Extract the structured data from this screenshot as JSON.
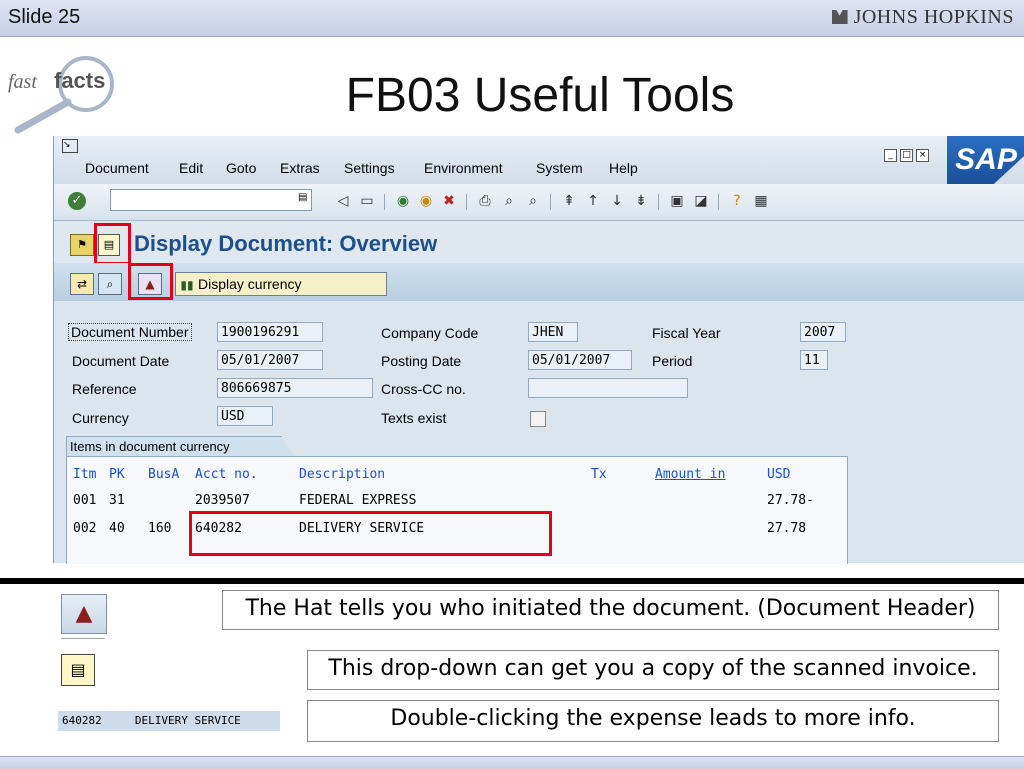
{
  "slide": {
    "number_label": "Slide 25",
    "logo_text": "JOHNS HOPKINS",
    "fastfacts_text1": "fast",
    "fastfacts_text2": "facts",
    "title": "FB03 Useful Tools"
  },
  "sap": {
    "logo": "SAP",
    "menu": [
      "Document",
      "Edit",
      "Goto",
      "Extras",
      "Settings",
      "Environment",
      "System",
      "Help"
    ],
    "screen_title": "Display Document: Overview",
    "display_currency_label": "Display currency",
    "header": {
      "document_number": {
        "label": "Document Number",
        "value": "1900196291"
      },
      "company_code": {
        "label": "Company Code",
        "value": "JHEN"
      },
      "fiscal_year": {
        "label": "Fiscal Year",
        "value": "2007"
      },
      "document_date": {
        "label": "Document Date",
        "value": "05/01/2007"
      },
      "posting_date": {
        "label": "Posting Date",
        "value": "05/01/2007"
      },
      "period": {
        "label": "Period",
        "value": "11"
      },
      "reference": {
        "label": "Reference",
        "value": "806669875"
      },
      "cross_cc": {
        "label": "Cross-CC no.",
        "value": ""
      },
      "currency": {
        "label": "Currency",
        "value": "USD"
      },
      "texts_exist": {
        "label": "Texts exist"
      }
    },
    "items": {
      "tab_label": "Items in document currency",
      "columns": {
        "itm": "Itm",
        "pk": "PK",
        "busa": "BusA",
        "acct": "Acct no.",
        "desc": "Description",
        "tx": "Tx",
        "amount": "Amount in",
        "cur": "USD"
      },
      "rows": [
        {
          "itm": "001",
          "pk": "31",
          "busa": "",
          "acct": "2039507",
          "desc": "FEDERAL EXPRESS",
          "amount": "27.78-"
        },
        {
          "itm": "002",
          "pk": "40",
          "busa": "160",
          "acct": "640282",
          "desc": "DELIVERY SERVICE",
          "amount": "27.78"
        }
      ]
    }
  },
  "notes": {
    "hat": "The Hat tells you who initiated the document. (Document Header)",
    "dropdown": "This drop-down can get you a copy of the scanned invoice.",
    "expense": "Double-clicking the expense leads to more info.",
    "snippet": "640282     DELIVERY SERVICE"
  },
  "colors": {
    "highlight": "#e2001a",
    "sap_blue": "#1e4f88",
    "column_header_blue": "#1e4fc4"
  }
}
